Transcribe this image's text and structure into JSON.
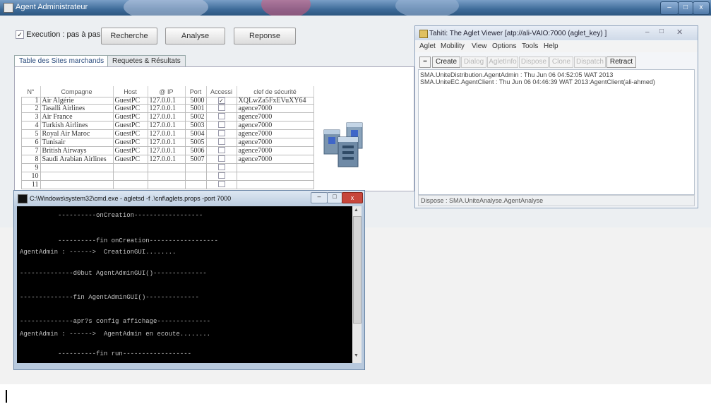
{
  "main_window": {
    "title": "Agent Administrateur",
    "execution_checkbox_label": "Execution : pas à pas",
    "buttons": {
      "recherche": "Recherche",
      "analyse": "Analyse",
      "reponse": "Reponse"
    },
    "tabs": [
      "Table des Sites marchands",
      "Requetes & Résultats"
    ],
    "table": {
      "headers": [
        "N°",
        "Compagne",
        "Host",
        "@ IP",
        "Port",
        "Accessi",
        "clef de sécurité"
      ],
      "rows": [
        [
          "1",
          "Air Algérie",
          "GuestPC",
          "127.0.0.1",
          "5000",
          "checked",
          "XQLwZa5FxEVuXY64"
        ],
        [
          "2",
          "Tasalli Airlines",
          "GuestPC",
          "127.0.0.1",
          "5001",
          "",
          "agence7000"
        ],
        [
          "3",
          "Air France",
          "GuestPC",
          "127.0.0.1",
          "5002",
          "",
          "agence7000"
        ],
        [
          "4",
          "Turkish Airlines",
          "GuestPC",
          "127.0.0.1",
          "5003",
          "",
          "agence7000"
        ],
        [
          "5",
          "Royal Air Maroc",
          "GuestPC",
          "127.0.0.1",
          "5004",
          "",
          "agence7000"
        ],
        [
          "6",
          "Tunisair",
          "GuestPC",
          "127.0.0.1",
          "5005",
          "",
          "agence7000"
        ],
        [
          "7",
          "British Airways",
          "GuestPC",
          "127.0.0.1",
          "5006",
          "",
          "agence7000"
        ],
        [
          "8",
          "Saudi Arabian Airlines",
          "GuestPC",
          "127.0.0.1",
          "5007",
          "",
          "agence7000"
        ],
        [
          "9",
          "",
          "",
          "",
          "",
          "",
          ""
        ],
        [
          "10",
          "",
          "",
          "",
          "",
          "",
          ""
        ],
        [
          "11",
          "",
          "",
          "",
          "",
          "",
          ""
        ]
      ]
    }
  },
  "aglet_viewer": {
    "title": "Tahiti: The Aglet Viewer [atp://ali-VAIO:7000 (aglet_key) ]",
    "menu": [
      "Aglet",
      "Mobility",
      "View",
      "Options",
      "Tools",
      "Help"
    ],
    "toolbar": [
      "Create",
      "Dialog",
      "AgletInfo",
      "Dispose",
      "Clone",
      "Dispatch",
      "Retract"
    ],
    "log": [
      "SMA.UniteDistribution.AgentAdmin : Thu Jun 06 04:52:05 WAT 2013",
      "SMA.UniteEC.AgentClient : Thu Jun 06 04:46:39 WAT 2013:AgentClient(ali-ahmed)"
    ],
    "status": "Dispose : SMA.UniteAnalyse.AgentAnalyse"
  },
  "cmd_window": {
    "title": "C:\\Windows\\system32\\cmd.exe - agletsd  -f .\\cnf\\aglets.props -port 7000",
    "lines": [
      "          ----------onCreation------------------",
      "",
      "          ----------fin onCreation------------------",
      "AgentAdmin : ------>  CreationGUI........",
      "",
      "--------------d0but AgentAdminGUI()--------------",
      "",
      "--------------fin AgentAdminGUI()--------------",
      "",
      "--------------apr?s config affichage--------------",
      "AgentAdmin : ------>  AgentAdmin en ecoute........",
      "",
      "          ----------fin run------------------"
    ]
  },
  "colors": {
    "titlebar": "#3e6b99",
    "cmd_background": "#000000",
    "close_button": "#c7463b"
  }
}
